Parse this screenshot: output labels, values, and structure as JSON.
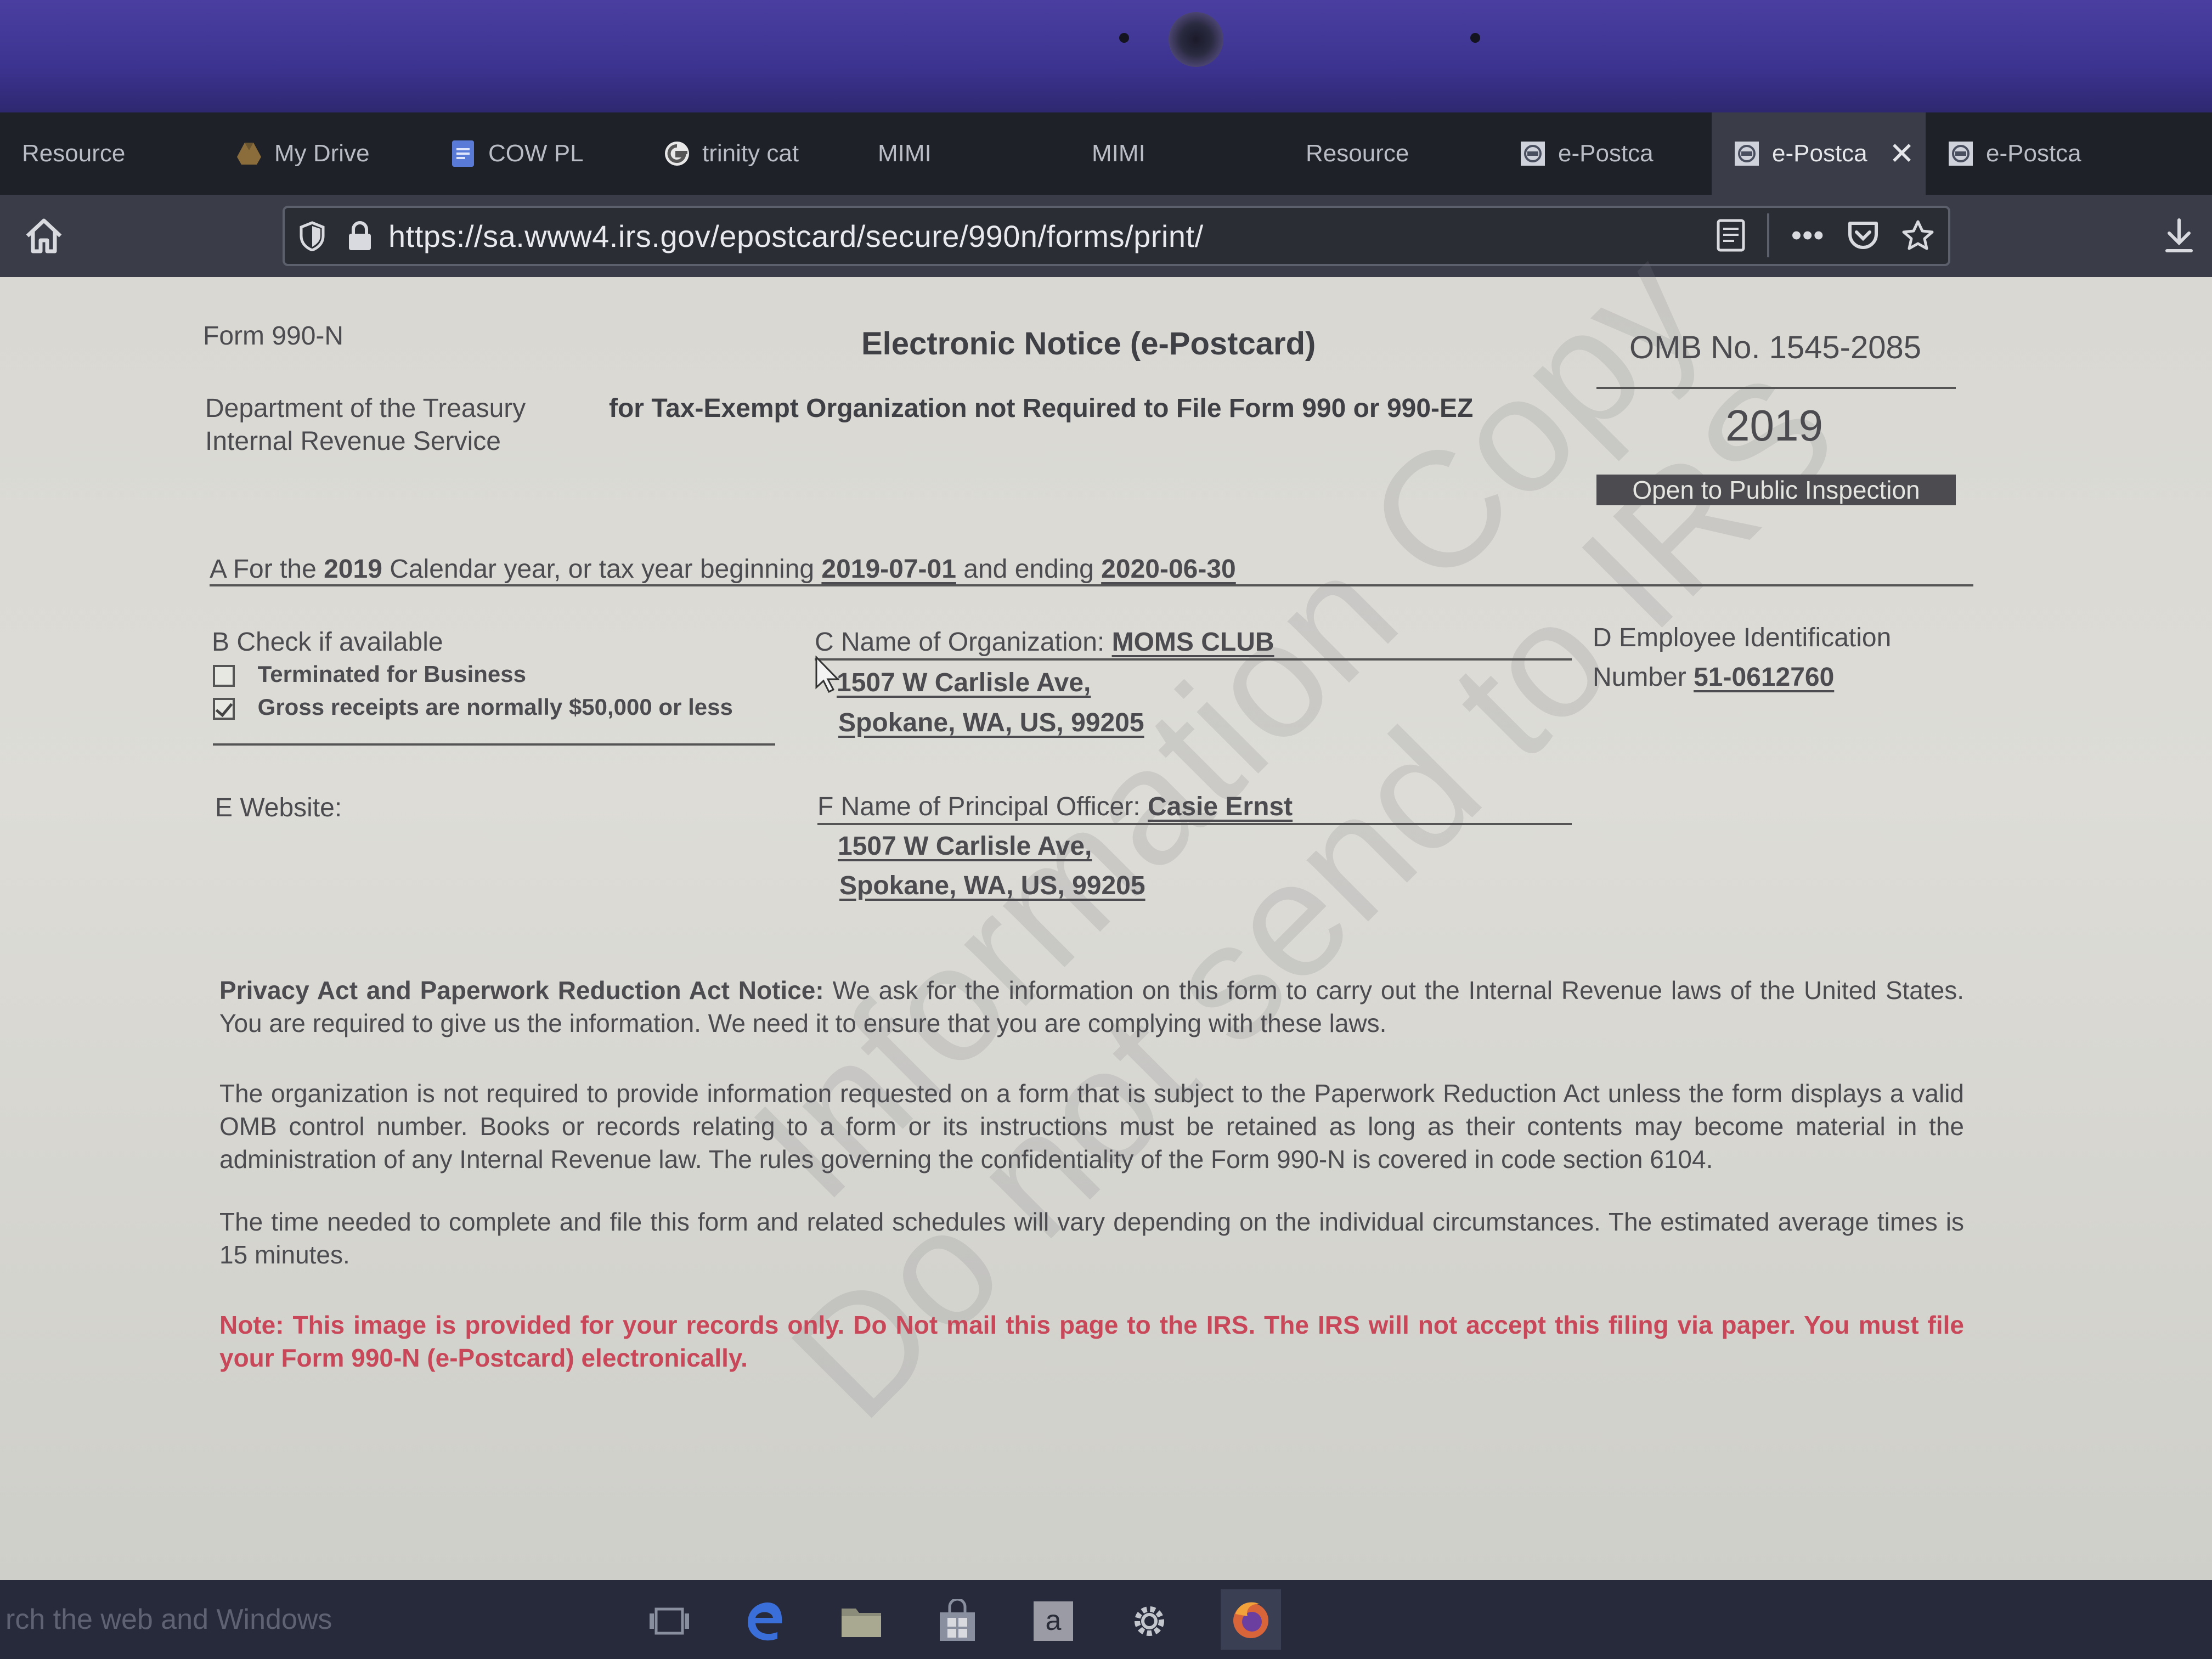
{
  "browser": {
    "tabs": [
      {
        "label": "Resource",
        "icon": ""
      },
      {
        "label": "My Drive",
        "icon": "google-drive-icon"
      },
      {
        "label": "COW PL",
        "icon": "google-docs-icon"
      },
      {
        "label": "trinity cat",
        "icon": "google-icon"
      },
      {
        "label": "MIMI",
        "icon": ""
      },
      {
        "label": "MIMI",
        "icon": ""
      },
      {
        "label": "Resource",
        "icon": ""
      },
      {
        "label": "e-Postca",
        "icon": "irs-seal-icon"
      },
      {
        "label": "e-Postca",
        "icon": "irs-seal-icon",
        "active": true
      },
      {
        "label": "e-Postca",
        "icon": "irs-seal-icon"
      }
    ],
    "url": "https://sa.www4.irs.gov/epostcard/secure/990n/forms/print/",
    "more_label": "•••"
  },
  "form": {
    "form_number": "Form 990-N",
    "title": "Electronic Notice (e-Postcard)",
    "omb": "OMB No. 1545-2085",
    "dept_line1": "Department of the Treasury",
    "dept_line2": "Internal Revenue Service",
    "subtitle": "for Tax-Exempt Organization not Required to File Form 990 or 990-EZ",
    "year": "2019",
    "public_inspection": "Open to Public Inspection",
    "line_a": {
      "prefix": "A For the",
      "year": "2019",
      "middle": "Calendar year, or tax year beginning",
      "begin": "2019-07-01",
      "and_ending": "and ending",
      "end": "2020-06-30"
    },
    "section_b": {
      "label": "B Check if available",
      "terminated_label": "Terminated for Business",
      "terminated_checked": false,
      "gross_label": "Gross receipts are normally $50,000 or less",
      "gross_checked": true
    },
    "section_c": {
      "label": "C Name of Organization:",
      "name": "MOMS CLUB",
      "address1": "1507 W Carlisle Ave,",
      "address2": "Spokane, WA, US, 99205"
    },
    "section_d": {
      "label1": "D Employee Identification",
      "label2": "Number",
      "ein": "51-0612760"
    },
    "section_e": {
      "label": "E Website:"
    },
    "section_f": {
      "label": "F Name of Principal Officer:",
      "name": "Casie Ernst",
      "address1": "1507 W Carlisle Ave,",
      "address2": "Spokane, WA, US, 99205"
    },
    "privacy_heading": "Privacy Act and Paperwork Reduction Act Notice:",
    "privacy_text": "We ask for the information on this form to carry out the Internal Revenue laws of the United States. You are required to give us the information. We need it to ensure that you are complying with these laws.",
    "para2": "The organization is not required to provide information requested on a form that is subject to the Paperwork Reduction Act unless the form displays a valid OMB control number. Books or records relating to a form or its instructions must be retained as long as their contents may become material in the administration of any Internal Revenue law. The rules governing the confidentiality of the Form 990-N is covered in code section 6104.",
    "para3": "The time needed to complete and file this form and related schedules will vary depending on the individual circumstances. The estimated average times is 15 minutes.",
    "note": "Note: This image is provided for your records only. Do Not mail this page to the IRS. The IRS will not accept this filing via paper. You must file your Form 990-N (e-Postcard) electronically.",
    "watermark_line1": "Information Copy",
    "watermark_line2": "Do not send to IRS"
  },
  "taskbar": {
    "search_placeholder": "rch the web and Windows",
    "apps": [
      "task-view-icon",
      "edge-icon",
      "file-explorer-icon",
      "store-icon",
      "amazon-icon",
      "settings-icon",
      "firefox-icon"
    ]
  },
  "colors": {
    "note_red": "#c8485a",
    "tab_bar": "#1f2128",
    "toolbar": "#3a3d48",
    "page_bg": "#dad9d3",
    "bezel": "#4a3fa0"
  }
}
